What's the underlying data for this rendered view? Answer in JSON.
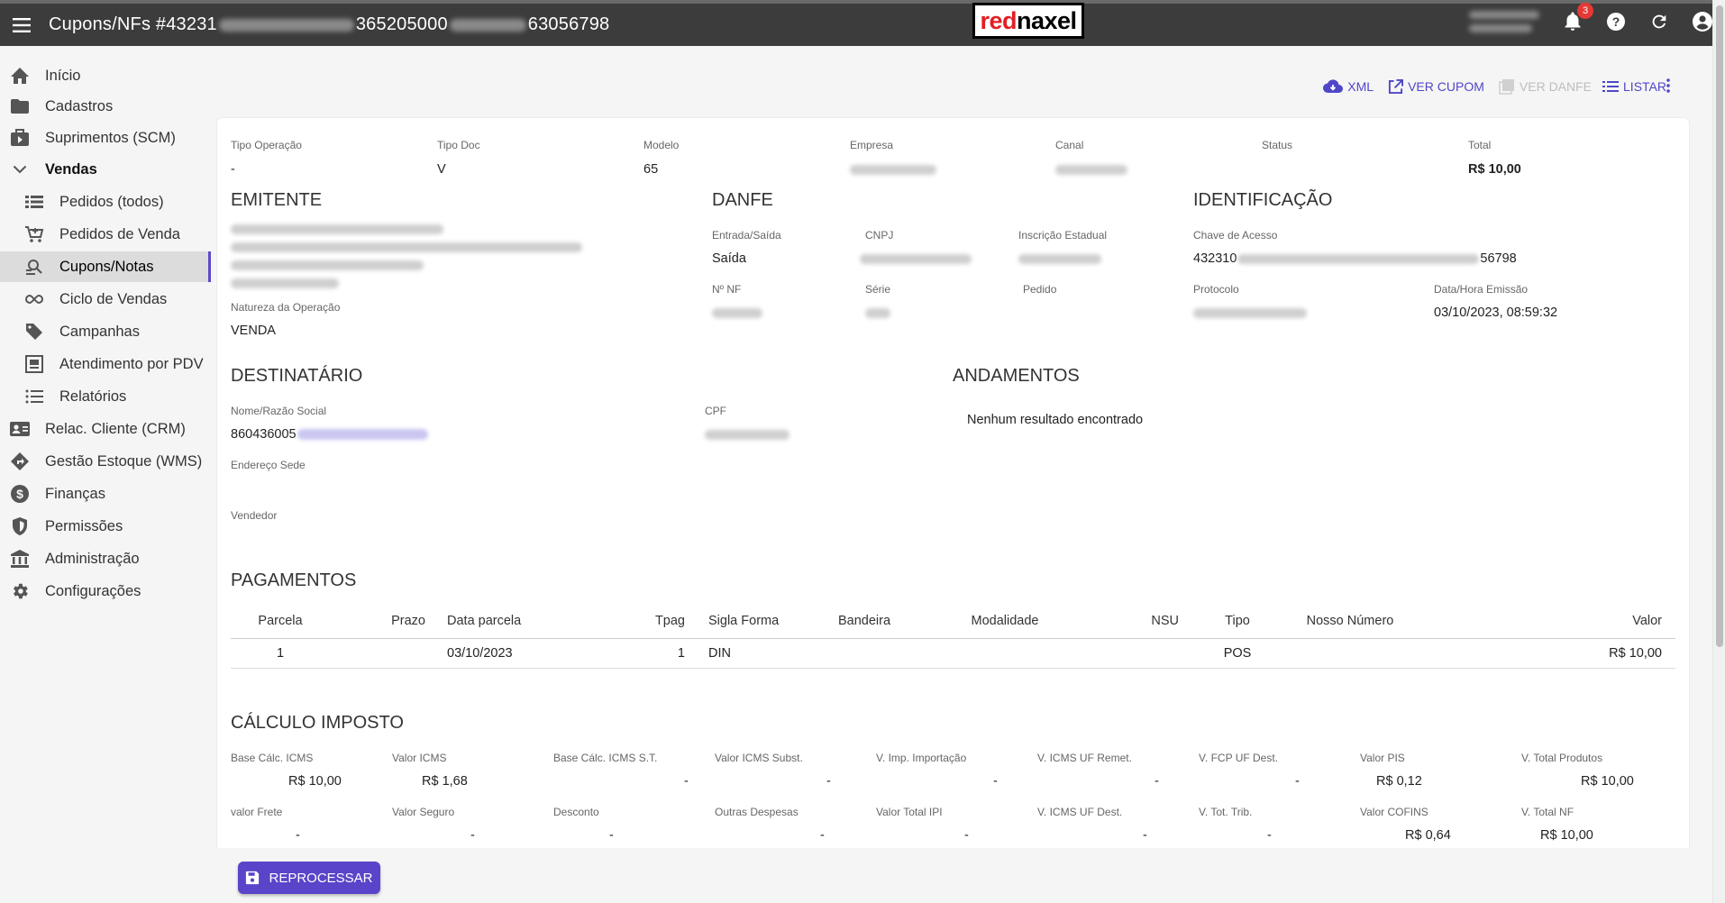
{
  "header": {
    "title_start": "Cupons/NFs #43231",
    "title_mid1": "365205000",
    "title_end": "63056798",
    "logo_red": "red",
    "logo_black": "naxel",
    "notification_count": "3"
  },
  "sidebar": {
    "items": [
      {
        "label": "Início",
        "icon": "home-icon"
      },
      {
        "label": "Cadastros",
        "icon": "folder-icon"
      },
      {
        "label": "Suprimentos (SCM)",
        "icon": "supply-icon"
      },
      {
        "label": "Vendas",
        "icon": "chevron-down-icon"
      },
      {
        "label": "Pedidos (todos)",
        "icon": "list-icon"
      },
      {
        "label": "Pedidos de Venda",
        "icon": "cart-icon"
      },
      {
        "label": "Cupons/Notas",
        "icon": "search-doc-icon"
      },
      {
        "label": "Ciclo de Vendas",
        "icon": "infinity-icon"
      },
      {
        "label": "Campanhas",
        "icon": "tag-icon"
      },
      {
        "label": "Atendimento por PDV",
        "icon": "pdv-icon"
      },
      {
        "label": "Relatórios",
        "icon": "report-list-icon"
      },
      {
        "label": "Relac. Cliente (CRM)",
        "icon": "contact-icon"
      },
      {
        "label": "Gestão Estoque (WMS)",
        "icon": "directions-icon"
      },
      {
        "label": "Finanças",
        "icon": "dollar-icon"
      },
      {
        "label": "Permissões",
        "icon": "shield-icon"
      },
      {
        "label": "Administração",
        "icon": "bank-icon"
      },
      {
        "label": "Configurações",
        "icon": "gear-icon"
      }
    ]
  },
  "toolbar": {
    "xml": "XML",
    "ver_cupom": "VER CUPOM",
    "ver_danfe": "VER DANFE",
    "listar": "LISTAR"
  },
  "summary": {
    "tipo_operacao_label": "Tipo Operação",
    "tipo_operacao": "-",
    "tipo_doc_label": "Tipo Doc",
    "tipo_doc": "V",
    "modelo_label": "Modelo",
    "modelo": "65",
    "empresa_label": "Empresa",
    "canal_label": "Canal",
    "status_label": "Status",
    "total_label": "Total",
    "total": "R$ 10,00"
  },
  "emitente": {
    "title": "EMITENTE",
    "natureza_label": "Natureza da Operação",
    "natureza": "VENDA"
  },
  "danfe": {
    "title": "DANFE",
    "entrada_saida_label": "Entrada/Saída",
    "entrada_saida": "Saída",
    "cnpj_label": "CNPJ",
    "ie_label": "Inscrição Estadual",
    "nf_label": "Nº NF",
    "serie_label": "Série",
    "pedido_label": "Pedido"
  },
  "identificacao": {
    "title": "IDENTIFICAÇÃO",
    "chave_label": "Chave de Acesso",
    "chave_start": "432310",
    "chave_end": "56798",
    "protocolo_label": "Protocolo",
    "data_label": "Data/Hora Emissão",
    "data": "03/10/2023, 08:59:32"
  },
  "destinatario": {
    "title": "DESTINATÁRIO",
    "nome_label": "Nome/Razão Social",
    "nome_start": "860436005",
    "cpf_label": "CPF",
    "endereco_label": "Endereço Sede",
    "vendedor_label": "Vendedor"
  },
  "andamentos": {
    "title": "ANDAMENTOS",
    "empty": "Nenhum resultado encontrado"
  },
  "pagamentos": {
    "title": "PAGAMENTOS",
    "headers": [
      "Parcela",
      "Prazo",
      "Data parcela",
      "Tpag",
      "Sigla Forma",
      "Bandeira",
      "Modalidade",
      "NSU",
      "Tipo",
      "Nosso Número",
      "Valor"
    ],
    "rows": [
      [
        "1",
        "",
        "03/10/2023",
        "1",
        "DIN",
        "",
        "",
        "",
        "POS",
        "",
        "R$ 10,00"
      ]
    ]
  },
  "calculo": {
    "title": "CÁLCULO IMPOSTO",
    "row1": [
      {
        "label": "Base Cálc. ICMS",
        "value": "R$ 10,00"
      },
      {
        "label": "Valor ICMS",
        "value": "R$ 1,68"
      },
      {
        "label": "Base Cálc. ICMS S.T.",
        "value": "-"
      },
      {
        "label": "Valor ICMS Subst.",
        "value": "-"
      },
      {
        "label": "V. Imp. Importação",
        "value": "-"
      },
      {
        "label": "V. ICMS UF Remet.",
        "value": "-"
      },
      {
        "label": "V. FCP UF Dest.",
        "value": "-"
      },
      {
        "label": "Valor PIS",
        "value": "R$ 0,12"
      },
      {
        "label": "V. Total Produtos",
        "value": "R$ 10,00"
      }
    ],
    "row2": [
      {
        "label": "valor Frete",
        "value": "-"
      },
      {
        "label": "Valor Seguro",
        "value": "-"
      },
      {
        "label": "Desconto",
        "value": "-"
      },
      {
        "label": "Outras Despesas",
        "value": "-"
      },
      {
        "label": "Valor Total IPI",
        "value": "-"
      },
      {
        "label": "V. ICMS UF Dest.",
        "value": "-"
      },
      {
        "label": "V. Tot. Trib.",
        "value": "-"
      },
      {
        "label": "Valor COFINS",
        "value": "R$ 0,64"
      },
      {
        "label": "V. Total NF",
        "value": "R$ 10,00"
      }
    ]
  },
  "actions": {
    "reprocessar": "REPROCESSAR"
  },
  "colors": {
    "topbar": "#3c3c3c",
    "accent": "#5046c8",
    "button": "#5a44c9",
    "badge": "#e53935"
  }
}
